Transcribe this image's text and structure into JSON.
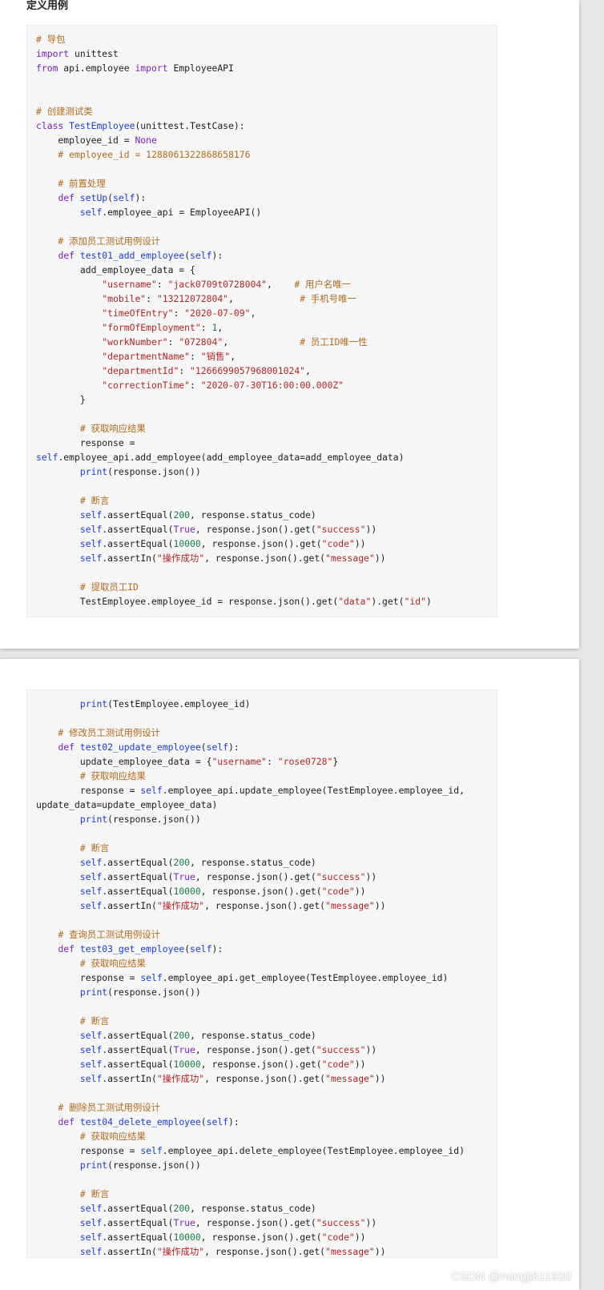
{
  "section_title": "定义用例",
  "watermark": "CSDN @mingji811920",
  "block1": [
    [
      [
        "c",
        "# 导包"
      ]
    ],
    [
      [
        "k",
        "import"
      ],
      [
        "p",
        " unittest"
      ]
    ],
    [
      [
        "k",
        "from"
      ],
      [
        "p",
        " api.employee "
      ],
      [
        "k",
        "import"
      ],
      [
        "p",
        " EmployeeAPI"
      ]
    ],
    [],
    [],
    [
      [
        "c",
        "# 创建测试类"
      ]
    ],
    [
      [
        "k",
        "class"
      ],
      [
        "p",
        " "
      ],
      [
        "f",
        "TestEmployee"
      ],
      [
        "p",
        "(unittest.TestCase):"
      ]
    ],
    [
      [
        "p",
        "    employee_id = "
      ],
      [
        "k",
        "None"
      ]
    ],
    [
      [
        "c",
        "    # employee_id = 1288061322868658176"
      ]
    ],
    [],
    [
      [
        "c",
        "    # 前置处理"
      ]
    ],
    [
      [
        "p",
        "    "
      ],
      [
        "k",
        "def"
      ],
      [
        "p",
        " "
      ],
      [
        "f",
        "setUp"
      ],
      [
        "p",
        "("
      ],
      [
        "f",
        "self"
      ],
      [
        "p",
        "):"
      ]
    ],
    [
      [
        "p",
        "        "
      ],
      [
        "f",
        "self"
      ],
      [
        "p",
        ".employee_api = EmployeeAPI()"
      ]
    ],
    [],
    [
      [
        "c",
        "    # 添加员工测试用例设计"
      ]
    ],
    [
      [
        "p",
        "    "
      ],
      [
        "k",
        "def"
      ],
      [
        "p",
        " "
      ],
      [
        "f",
        "test01_add_employee"
      ],
      [
        "p",
        "("
      ],
      [
        "f",
        "self"
      ],
      [
        "p",
        "):"
      ]
    ],
    [
      [
        "p",
        "        add_employee_data = {"
      ]
    ],
    [
      [
        "p",
        "            "
      ],
      [
        "s",
        "\"username\""
      ],
      [
        "p",
        ": "
      ],
      [
        "s",
        "\"jack0709t0728004\""
      ],
      [
        "p",
        ",    "
      ],
      [
        "c",
        "# 用户名唯一"
      ]
    ],
    [
      [
        "p",
        "            "
      ],
      [
        "s",
        "\"mobile\""
      ],
      [
        "p",
        ": "
      ],
      [
        "s",
        "\"13212072804\""
      ],
      [
        "p",
        ",            "
      ],
      [
        "c",
        "# 手机号唯一"
      ]
    ],
    [
      [
        "p",
        "            "
      ],
      [
        "s",
        "\"timeOfEntry\""
      ],
      [
        "p",
        ": "
      ],
      [
        "s",
        "\"2020-07-09\""
      ],
      [
        "p",
        ","
      ]
    ],
    [
      [
        "p",
        "            "
      ],
      [
        "s",
        "\"formOfEmployment\""
      ],
      [
        "p",
        ": "
      ],
      [
        "n",
        "1"
      ],
      [
        "p",
        ","
      ]
    ],
    [
      [
        "p",
        "            "
      ],
      [
        "s",
        "\"workNumber\""
      ],
      [
        "p",
        ": "
      ],
      [
        "s",
        "\"072804\""
      ],
      [
        "p",
        ",             "
      ],
      [
        "c",
        "# 员工ID唯一性"
      ]
    ],
    [
      [
        "p",
        "            "
      ],
      [
        "s",
        "\"departmentName\""
      ],
      [
        "p",
        ": "
      ],
      [
        "s",
        "\"销售\""
      ],
      [
        "p",
        ","
      ]
    ],
    [
      [
        "p",
        "            "
      ],
      [
        "s",
        "\"departmentId\""
      ],
      [
        "p",
        ": "
      ],
      [
        "s",
        "\"1266699057968001024\""
      ],
      [
        "p",
        ","
      ]
    ],
    [
      [
        "p",
        "            "
      ],
      [
        "s",
        "\"correctionTime\""
      ],
      [
        "p",
        ": "
      ],
      [
        "s",
        "\"2020-07-30T16:00:00.000Z\""
      ]
    ],
    [
      [
        "p",
        "        }"
      ]
    ],
    [],
    [
      [
        "c",
        "        # 获取响应结果"
      ]
    ],
    [
      [
        "p",
        "        response ="
      ]
    ],
    [
      [
        "f",
        "self"
      ],
      [
        "p",
        ".employee_api.add_employee(add_employee_data=add_employee_data)"
      ]
    ],
    [
      [
        "p",
        "        "
      ],
      [
        "f",
        "print"
      ],
      [
        "p",
        "(response.json())"
      ]
    ],
    [],
    [
      [
        "c",
        "        # 断言"
      ]
    ],
    [
      [
        "p",
        "        "
      ],
      [
        "f",
        "self"
      ],
      [
        "p",
        ".assertEqual("
      ],
      [
        "n",
        "200"
      ],
      [
        "p",
        ", response.status_code)"
      ]
    ],
    [
      [
        "p",
        "        "
      ],
      [
        "f",
        "self"
      ],
      [
        "p",
        ".assertEqual("
      ],
      [
        "k",
        "True"
      ],
      [
        "p",
        ", response.json().get("
      ],
      [
        "s",
        "\"success\""
      ],
      [
        "p",
        "))"
      ]
    ],
    [
      [
        "p",
        "        "
      ],
      [
        "f",
        "self"
      ],
      [
        "p",
        ".assertEqual("
      ],
      [
        "n",
        "10000"
      ],
      [
        "p",
        ", response.json().get("
      ],
      [
        "s",
        "\"code\""
      ],
      [
        "p",
        "))"
      ]
    ],
    [
      [
        "p",
        "        "
      ],
      [
        "f",
        "self"
      ],
      [
        "p",
        ".assertIn("
      ],
      [
        "s",
        "\"操作成功\""
      ],
      [
        "p",
        ", response.json().get("
      ],
      [
        "s",
        "\"message\""
      ],
      [
        "p",
        "))"
      ]
    ],
    [],
    [
      [
        "c",
        "        # 提取员工ID"
      ]
    ],
    [
      [
        "p",
        "        TestEmployee.employee_id = response.json().get("
      ],
      [
        "s",
        "\"data\""
      ],
      [
        "p",
        ").get("
      ],
      [
        "s",
        "\"id\""
      ],
      [
        "p",
        ")"
      ]
    ]
  ],
  "block2": [
    [
      [
        "p",
        "        "
      ],
      [
        "f",
        "print"
      ],
      [
        "p",
        "(TestEmployee.employee_id)"
      ]
    ],
    [],
    [
      [
        "c",
        "    # 修改员工测试用例设计"
      ]
    ],
    [
      [
        "p",
        "    "
      ],
      [
        "k",
        "def"
      ],
      [
        "p",
        " "
      ],
      [
        "f",
        "test02_update_employee"
      ],
      [
        "p",
        "("
      ],
      [
        "f",
        "self"
      ],
      [
        "p",
        "):"
      ]
    ],
    [
      [
        "p",
        "        update_employee_data = {"
      ],
      [
        "s",
        "\"username\""
      ],
      [
        "p",
        ": "
      ],
      [
        "s",
        "\"rose0728\""
      ],
      [
        "p",
        "}"
      ]
    ],
    [
      [
        "c",
        "        # 获取响应结果"
      ]
    ],
    [
      [
        "p",
        "        response = "
      ],
      [
        "f",
        "self"
      ],
      [
        "p",
        ".employee_api.update_employee(TestEmployee.employee_id,"
      ]
    ],
    [
      [
        "p",
        "update_data=update_employee_data)"
      ]
    ],
    [
      [
        "p",
        "        "
      ],
      [
        "f",
        "print"
      ],
      [
        "p",
        "(response.json())"
      ]
    ],
    [],
    [
      [
        "c",
        "        # 断言"
      ]
    ],
    [
      [
        "p",
        "        "
      ],
      [
        "f",
        "self"
      ],
      [
        "p",
        ".assertEqual("
      ],
      [
        "n",
        "200"
      ],
      [
        "p",
        ", response.status_code)"
      ]
    ],
    [
      [
        "p",
        "        "
      ],
      [
        "f",
        "self"
      ],
      [
        "p",
        ".assertEqual("
      ],
      [
        "k",
        "True"
      ],
      [
        "p",
        ", response.json().get("
      ],
      [
        "s",
        "\"success\""
      ],
      [
        "p",
        "))"
      ]
    ],
    [
      [
        "p",
        "        "
      ],
      [
        "f",
        "self"
      ],
      [
        "p",
        ".assertEqual("
      ],
      [
        "n",
        "10000"
      ],
      [
        "p",
        ", response.json().get("
      ],
      [
        "s",
        "\"code\""
      ],
      [
        "p",
        "))"
      ]
    ],
    [
      [
        "p",
        "        "
      ],
      [
        "f",
        "self"
      ],
      [
        "p",
        ".assertIn("
      ],
      [
        "s",
        "\"操作成功\""
      ],
      [
        "p",
        ", response.json().get("
      ],
      [
        "s",
        "\"message\""
      ],
      [
        "p",
        "))"
      ]
    ],
    [],
    [
      [
        "c",
        "    # 查询员工测试用例设计"
      ]
    ],
    [
      [
        "p",
        "    "
      ],
      [
        "k",
        "def"
      ],
      [
        "p",
        " "
      ],
      [
        "f",
        "test03_get_employee"
      ],
      [
        "p",
        "("
      ],
      [
        "f",
        "self"
      ],
      [
        "p",
        "):"
      ]
    ],
    [
      [
        "c",
        "        # 获取响应结果"
      ]
    ],
    [
      [
        "p",
        "        response = "
      ],
      [
        "f",
        "self"
      ],
      [
        "p",
        ".employee_api.get_employee(TestEmployee.employee_id)"
      ]
    ],
    [
      [
        "p",
        "        "
      ],
      [
        "f",
        "print"
      ],
      [
        "p",
        "(response.json())"
      ]
    ],
    [],
    [
      [
        "c",
        "        # 断言"
      ]
    ],
    [
      [
        "p",
        "        "
      ],
      [
        "f",
        "self"
      ],
      [
        "p",
        ".assertEqual("
      ],
      [
        "n",
        "200"
      ],
      [
        "p",
        ", response.status_code)"
      ]
    ],
    [
      [
        "p",
        "        "
      ],
      [
        "f",
        "self"
      ],
      [
        "p",
        ".assertEqual("
      ],
      [
        "k",
        "True"
      ],
      [
        "p",
        ", response.json().get("
      ],
      [
        "s",
        "\"success\""
      ],
      [
        "p",
        "))"
      ]
    ],
    [
      [
        "p",
        "        "
      ],
      [
        "f",
        "self"
      ],
      [
        "p",
        ".assertEqual("
      ],
      [
        "n",
        "10000"
      ],
      [
        "p",
        ", response.json().get("
      ],
      [
        "s",
        "\"code\""
      ],
      [
        "p",
        "))"
      ]
    ],
    [
      [
        "p",
        "        "
      ],
      [
        "f",
        "self"
      ],
      [
        "p",
        ".assertIn("
      ],
      [
        "s",
        "\"操作成功\""
      ],
      [
        "p",
        ", response.json().get("
      ],
      [
        "s",
        "\"message\""
      ],
      [
        "p",
        "))"
      ]
    ],
    [],
    [
      [
        "c",
        "    # 删除员工测试用例设计"
      ]
    ],
    [
      [
        "p",
        "    "
      ],
      [
        "k",
        "def"
      ],
      [
        "p",
        " "
      ],
      [
        "f",
        "test04_delete_employee"
      ],
      [
        "p",
        "("
      ],
      [
        "f",
        "self"
      ],
      [
        "p",
        "):"
      ]
    ],
    [
      [
        "c",
        "        # 获取响应结果"
      ]
    ],
    [
      [
        "p",
        "        response = "
      ],
      [
        "f",
        "self"
      ],
      [
        "p",
        ".employee_api.delete_employee(TestEmployee.employee_id)"
      ]
    ],
    [
      [
        "p",
        "        "
      ],
      [
        "f",
        "print"
      ],
      [
        "p",
        "(response.json())"
      ]
    ],
    [],
    [
      [
        "c",
        "        # 断言"
      ]
    ],
    [
      [
        "p",
        "        "
      ],
      [
        "f",
        "self"
      ],
      [
        "p",
        ".assertEqual("
      ],
      [
        "n",
        "200"
      ],
      [
        "p",
        ", response.status_code)"
      ]
    ],
    [
      [
        "p",
        "        "
      ],
      [
        "f",
        "self"
      ],
      [
        "p",
        ".assertEqual("
      ],
      [
        "k",
        "True"
      ],
      [
        "p",
        ", response.json().get("
      ],
      [
        "s",
        "\"success\""
      ],
      [
        "p",
        "))"
      ]
    ],
    [
      [
        "p",
        "        "
      ],
      [
        "f",
        "self"
      ],
      [
        "p",
        ".assertEqual("
      ],
      [
        "n",
        "10000"
      ],
      [
        "p",
        ", response.json().get("
      ],
      [
        "s",
        "\"code\""
      ],
      [
        "p",
        "))"
      ]
    ],
    [
      [
        "p",
        "        "
      ],
      [
        "f",
        "self"
      ],
      [
        "p",
        ".assertIn("
      ],
      [
        "s",
        "\"操作成功\""
      ],
      [
        "p",
        ", response.json().get("
      ],
      [
        "s",
        "\"message\""
      ],
      [
        "p",
        "))"
      ]
    ]
  ],
  "colors": {
    "comment": "#b26a1f",
    "keyword": "#7a22b6",
    "function": "#1b3ed6",
    "string": "#b32626",
    "number": "#1b7a47"
  }
}
